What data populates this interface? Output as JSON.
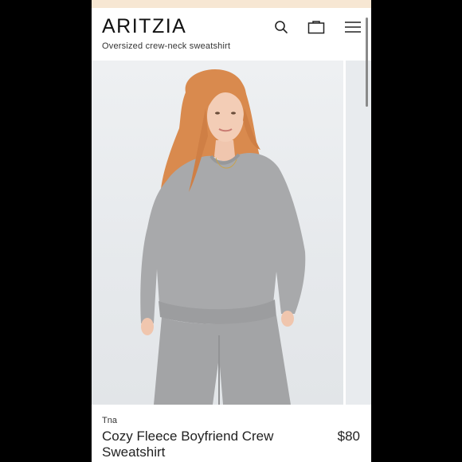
{
  "header": {
    "logo": "ARITZIA",
    "icons": [
      "search-icon",
      "shopping-bag-icon",
      "menu-icon"
    ]
  },
  "product": {
    "subtitle": "Oversized crew-neck sweatshirt",
    "brand": "Tna",
    "name": "Cozy Fleece Boyfriend Crew Sweatshirt",
    "price": "$80"
  },
  "colors": {
    "background": "#000000",
    "page": "#ffffff",
    "promo_bar": "#f7e7d3",
    "sweatshirt": "#a9aaac",
    "photo_backdrop": "#e9ecef"
  }
}
